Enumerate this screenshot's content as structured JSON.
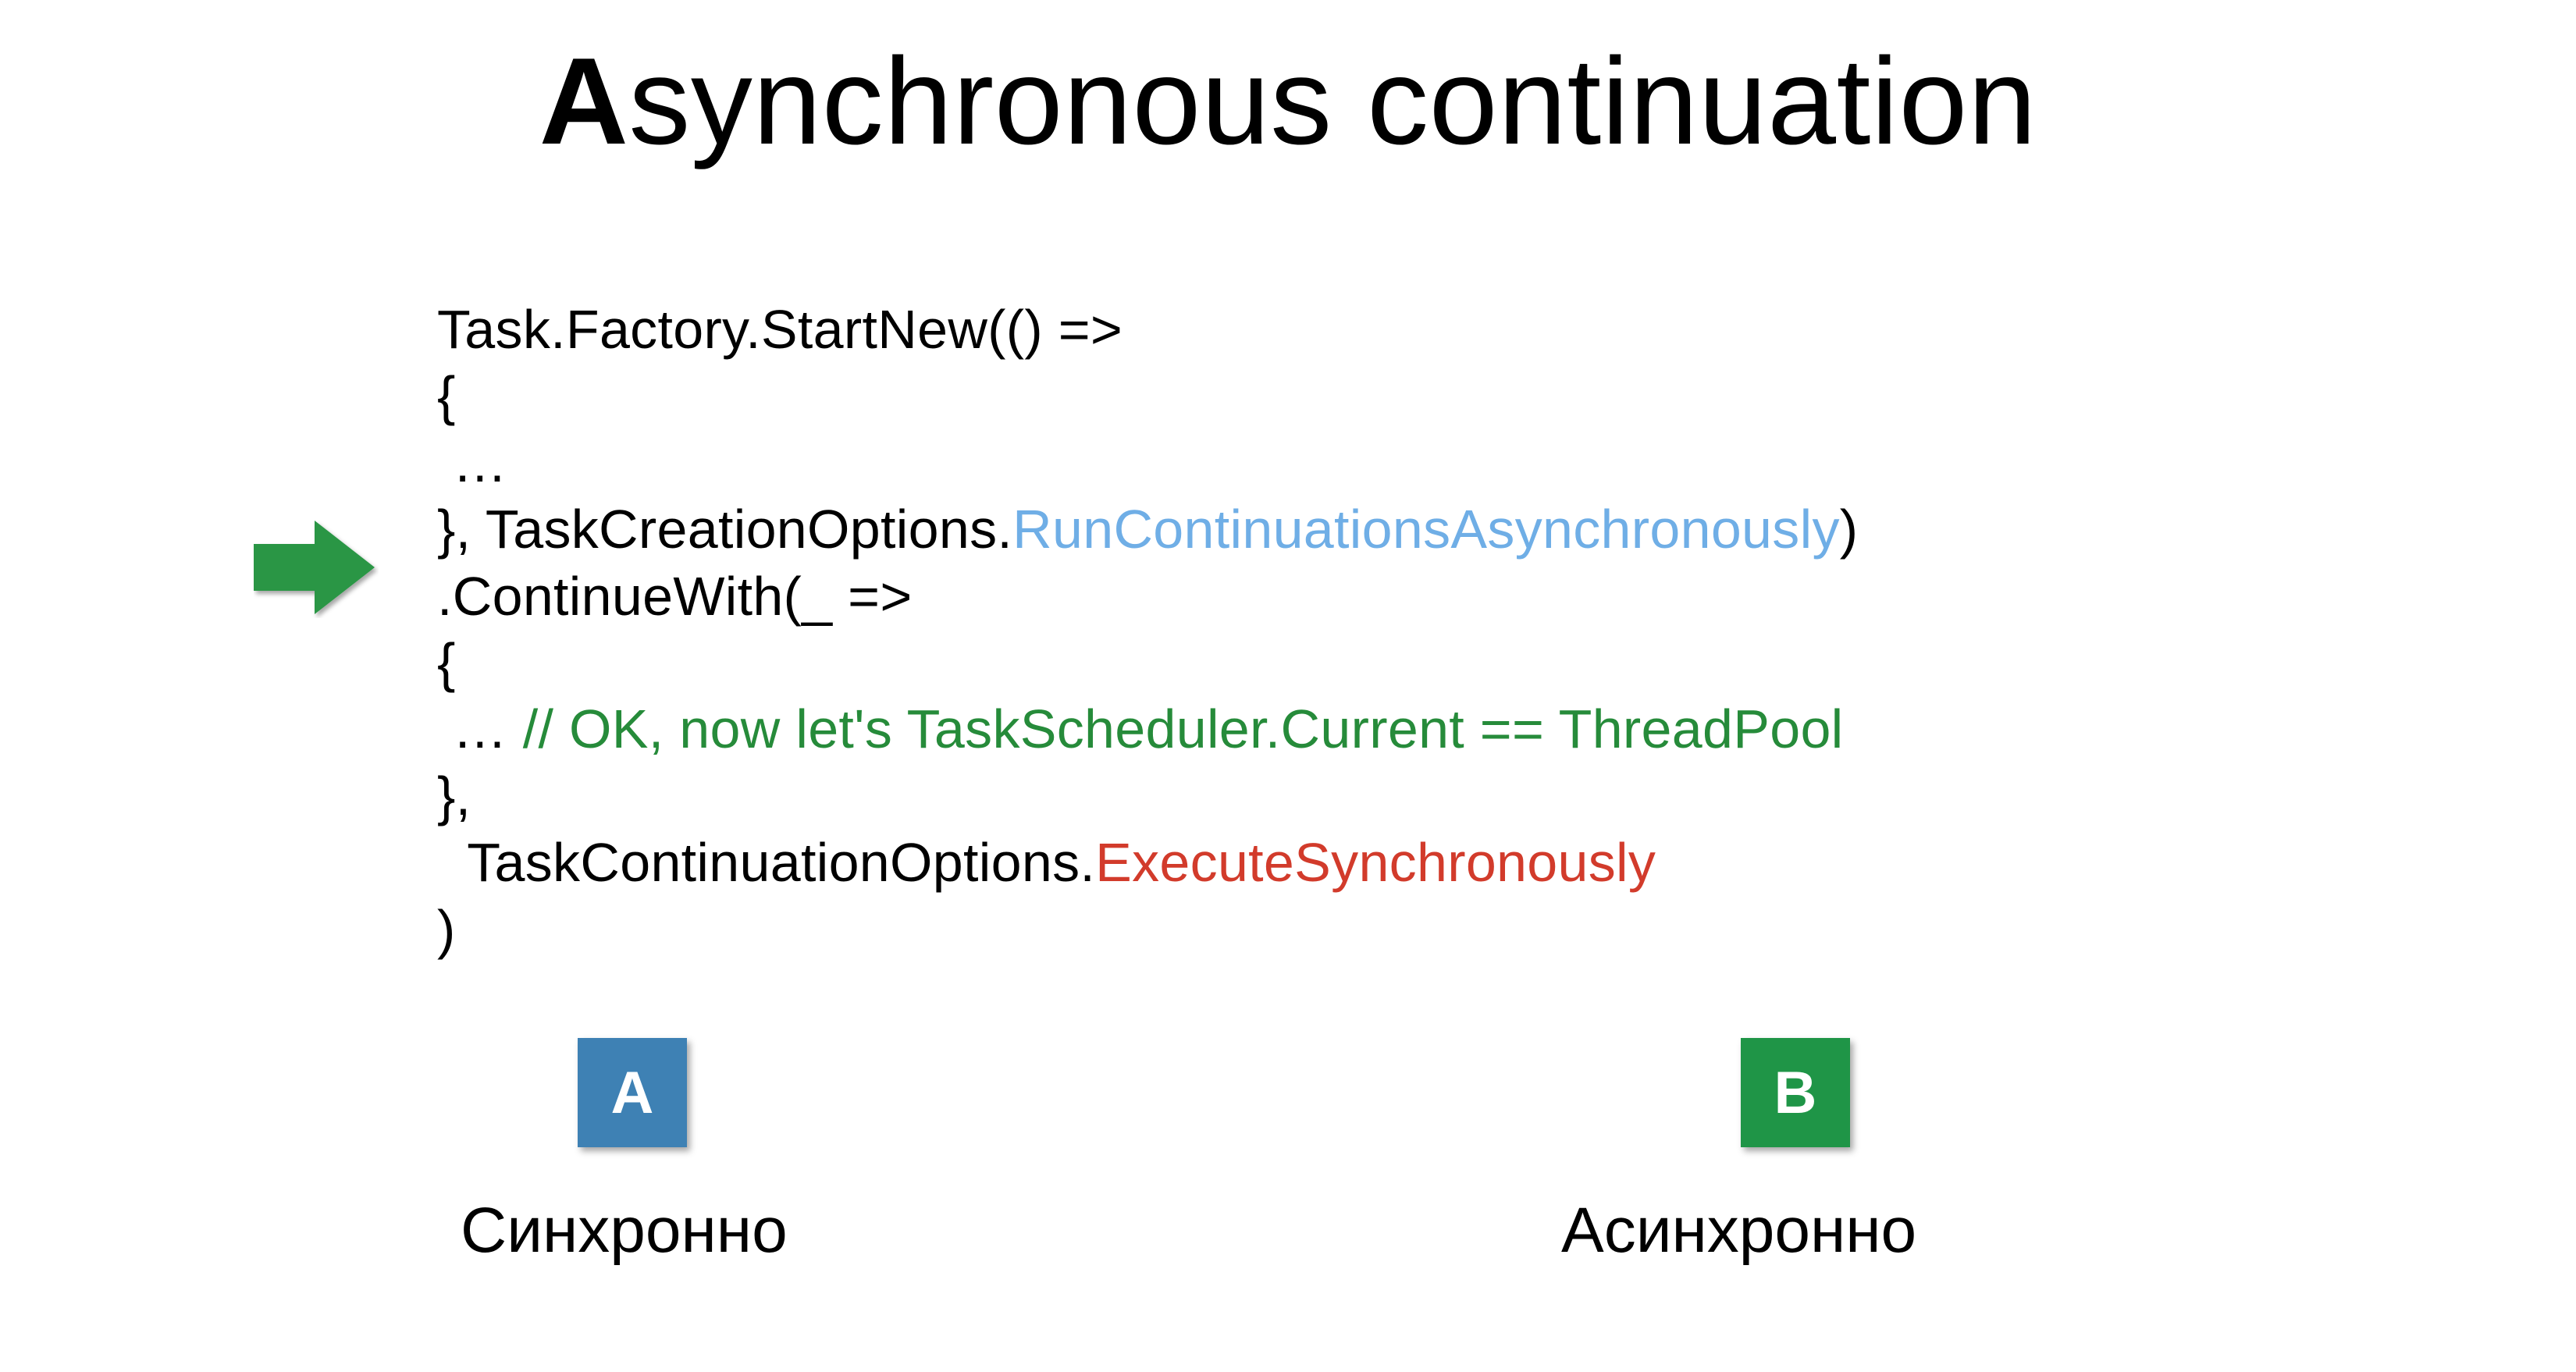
{
  "title_bold": "A",
  "title_rest": "synchronous continuation",
  "code": {
    "l1a": "Task.Factory.StartNew(() =>",
    "l2a": "{",
    "l3a": " …",
    "l4a": "}, TaskCreationOptions.",
    "l4b": "RunContinuationsAsynchronously",
    "l4c": ")",
    "l5a": ".ContinueWith(_ =>",
    "l6a": "{",
    "l7a": " … ",
    "l7b": "// OK, now let's TaskScheduler.Current == ThreadPool",
    "l8a": "},",
    "l9a": "  TaskContinuationOptions.",
    "l9b": "ExecuteSynchronously",
    "l10a": ")"
  },
  "badge_a": "A",
  "badge_b": "B",
  "caption_a": "Синхронно",
  "caption_b": "Асинхронно",
  "colors": {
    "blue": "#6faee6",
    "green": "#268b3a",
    "red": "#d23b2b",
    "badge_a_bg": "#3e81b4",
    "badge_b_bg": "#1f9547",
    "arrow": "#2a9645"
  }
}
